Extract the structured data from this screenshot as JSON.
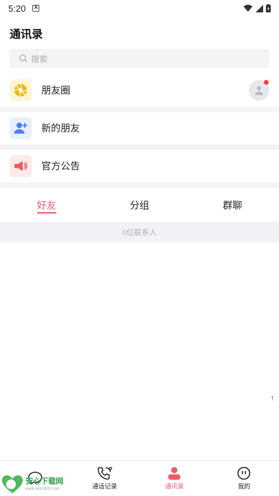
{
  "status_bar": {
    "time": "5:20",
    "notif_letter": "A"
  },
  "header": {
    "title": "通讯录"
  },
  "search": {
    "placeholder": "搜索"
  },
  "entries": [
    {
      "label": "朋友圈",
      "icon": "camera-shutter-icon",
      "color": "#f5b400"
    },
    {
      "label": "新的朋友",
      "icon": "add-user-icon",
      "color": "#4c7cf5"
    },
    {
      "label": "官方公告",
      "icon": "megaphone-icon",
      "color": "#f05a5a"
    }
  ],
  "tabs": [
    {
      "label": "好友",
      "active": true
    },
    {
      "label": "分组",
      "active": false
    },
    {
      "label": "群聊",
      "active": false
    }
  ],
  "contact_count": "0位联系人",
  "scroll_top": "↑",
  "bottom_nav": [
    {
      "label": "",
      "icon": "chat-bubble-icon",
      "active": false
    },
    {
      "label": "通话记录",
      "icon": "phone-call-icon",
      "active": false
    },
    {
      "label": "通讯录",
      "icon": "contacts-icon",
      "active": true
    },
    {
      "label": "我的",
      "icon": "profile-face-icon",
      "active": false
    }
  ],
  "watermark": {
    "title": "安心下载网",
    "sub": "www.anxz800.com"
  },
  "colors": {
    "accent": "#ee5a6b",
    "divider": "#f4f4f6"
  }
}
